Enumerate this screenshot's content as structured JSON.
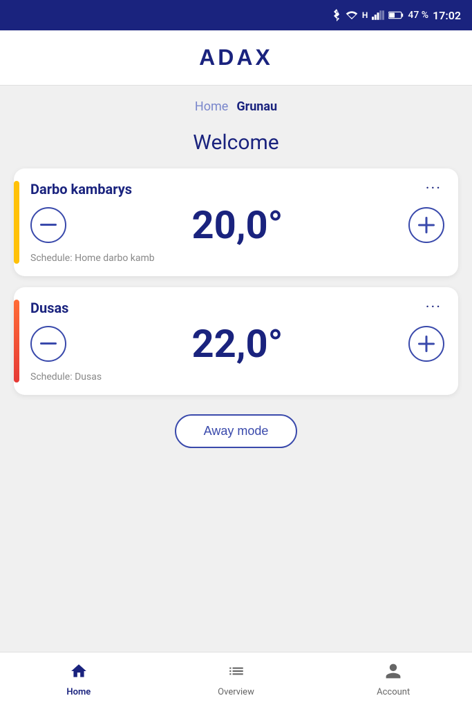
{
  "statusBar": {
    "battery": "47 %",
    "time": "17:02",
    "icons": [
      "bluetooth",
      "wifi",
      "signal",
      "battery"
    ]
  },
  "header": {
    "logo": "ADAX"
  },
  "breadcrumb": {
    "home_label": "Home",
    "current_label": "Grunau"
  },
  "welcome": {
    "title": "Welcome"
  },
  "devices": [
    {
      "id": "darbo-kambarys",
      "name": "Darbo kambarys",
      "temperature": "20,0°",
      "schedule": "Schedule: Home darbo kamb",
      "accent": "yellow"
    },
    {
      "id": "dusas",
      "name": "Dusas",
      "temperature": "22,0°",
      "schedule": "Schedule: Dusas",
      "accent": "orange-red"
    }
  ],
  "awayMode": {
    "label": "Away mode"
  },
  "bottomNav": {
    "items": [
      {
        "id": "home",
        "label": "Home",
        "icon": "home",
        "active": true
      },
      {
        "id": "overview",
        "label": "Overview",
        "icon": "list",
        "active": false
      },
      {
        "id": "account",
        "label": "Account",
        "icon": "person",
        "active": false
      }
    ]
  }
}
